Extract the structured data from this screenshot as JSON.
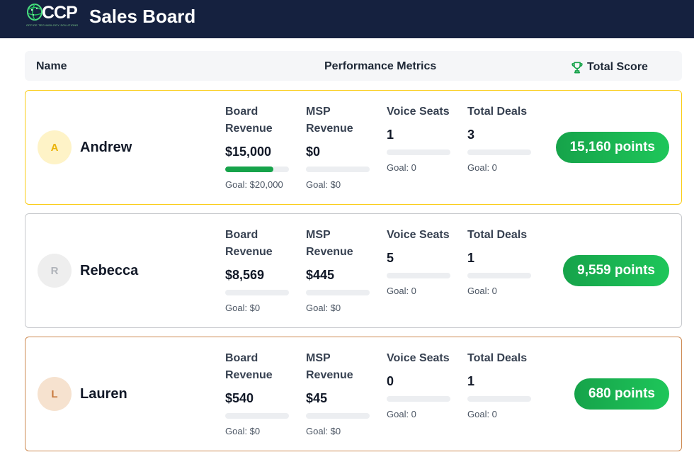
{
  "header": {
    "logo_text": "CCP",
    "logo_subtext": "OFFICE TECHNOLOGY SOLUTIONS",
    "title": "Sales Board"
  },
  "columns": {
    "name": "Name",
    "metrics": "Performance Metrics",
    "score": "Total Score",
    "score_icon": "trophy-icon"
  },
  "metric_labels": {
    "board_revenue": [
      "Board",
      "Revenue"
    ],
    "msp_revenue": [
      "MSP",
      "Revenue"
    ],
    "voice_seats": "Voice Seats",
    "total_deals": "Total Deals"
  },
  "colors": {
    "topbar": "#15213f",
    "points_badge": "#16a34a",
    "progress_fill": "#16a34a"
  },
  "rows": [
    {
      "initial": "A",
      "name": "Andrew",
      "board_revenue": "$15,000",
      "board_goal": "Goal: $20,000",
      "board_progress": 0.75,
      "msp_revenue": "$0",
      "msp_goal": "Goal: $0",
      "msp_progress": 0,
      "voice_seats": "1",
      "voice_goal": "Goal: 0",
      "voice_progress": 0,
      "total_deals": "3",
      "deals_goal": "Goal: 0",
      "deals_progress": 0,
      "points": "15,160 points",
      "border_color": "#facc15",
      "avatar_bg": "#fef3c7",
      "avatar_color": "#eab308"
    },
    {
      "initial": "R",
      "name": "Rebecca",
      "board_revenue": "$8,569",
      "board_goal": "Goal: $0",
      "board_progress": 0,
      "msp_revenue": "$445",
      "msp_goal": "Goal: $0",
      "msp_progress": 0,
      "voice_seats": "5",
      "voice_goal": "Goal: 0",
      "voice_progress": 0,
      "total_deals": "1",
      "deals_goal": "Goal: 0",
      "deals_progress": 0,
      "points": "9,559 points",
      "border_color": "#c7c9cd",
      "avatar_bg": "#eeeeee",
      "avatar_color": "#b0b4ba"
    },
    {
      "initial": "L",
      "name": "Lauren",
      "board_revenue": "$540",
      "board_goal": "Goal: $0",
      "board_progress": 0,
      "msp_revenue": "$45",
      "msp_goal": "Goal: $0",
      "msp_progress": 0,
      "voice_seats": "0",
      "voice_goal": "Goal: 0",
      "voice_progress": 0,
      "total_deals": "1",
      "deals_goal": "Goal: 0",
      "deals_progress": 0,
      "points": "680 points",
      "border_color": "#cd8a52",
      "avatar_bg": "#f6e2cf",
      "avatar_color": "#c87a3f"
    }
  ]
}
